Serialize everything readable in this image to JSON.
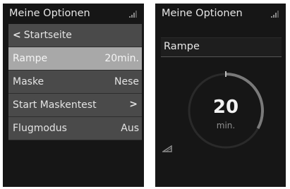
{
  "left_screen": {
    "title": "Meine Optionen",
    "back_item": {
      "label": "Startseite",
      "icon": "chevron-left-icon"
    },
    "items": [
      {
        "label": "Rampe",
        "value": "20min.",
        "selected": true
      },
      {
        "label": "Maske",
        "value": "Nese",
        "selected": false
      },
      {
        "label": "Start Maskentest",
        "value": "",
        "icon": "chevron-right-icon",
        "selected": false
      },
      {
        "label": "Flugmodus",
        "value": "Aus",
        "selected": false
      }
    ],
    "status_icon": "signal-icon"
  },
  "right_screen": {
    "title": "Meine Optionen",
    "field_label": "Rampe",
    "dial": {
      "value": "20",
      "unit": "min.",
      "fill_fraction": 0.33
    },
    "status_icon": "signal-icon",
    "ramp_icon": "ramp-icon"
  },
  "colors": {
    "screen_bg": "#161616",
    "row_bg": "#4a4a4a",
    "row_selected_bg": "#a8a8a8",
    "text": "#e6e6e6"
  }
}
